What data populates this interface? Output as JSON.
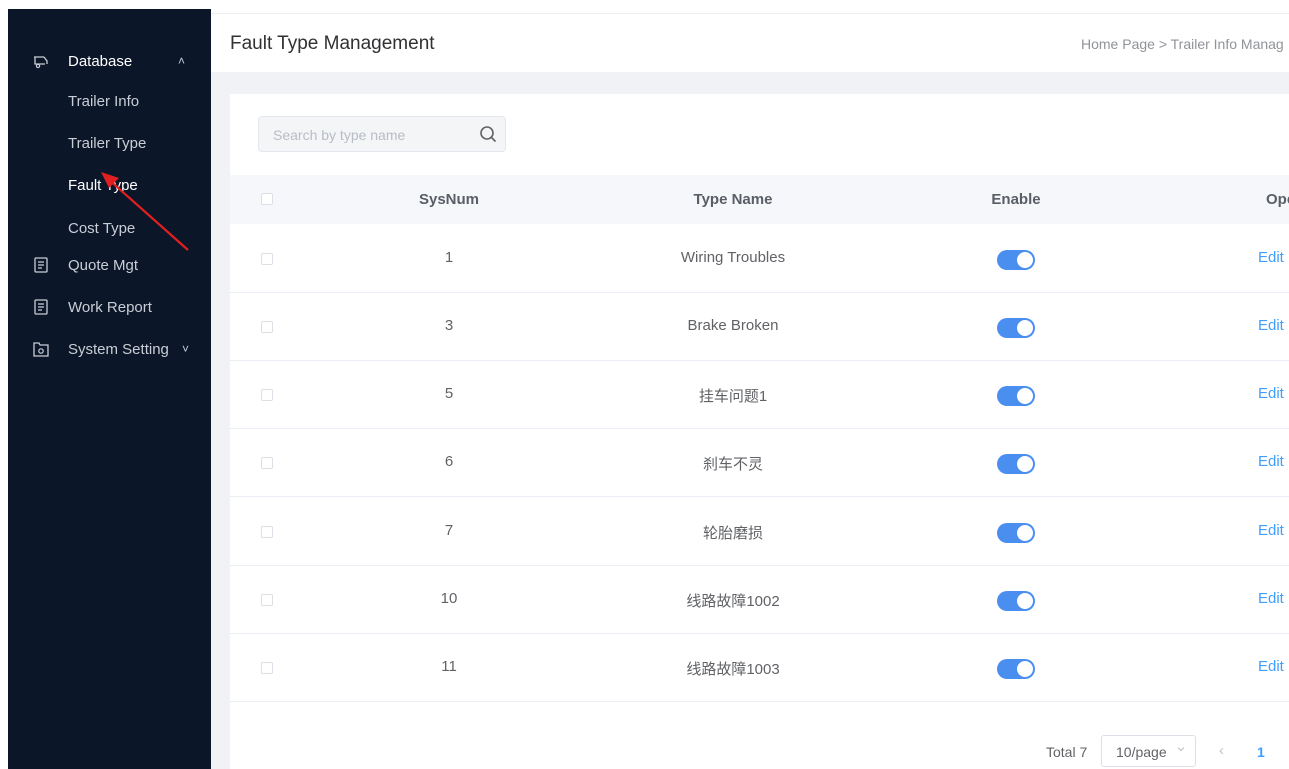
{
  "sidebar": {
    "database": {
      "label": "Database",
      "icon": "trailer-icon"
    },
    "submenu": [
      {
        "label": "Trailer Info"
      },
      {
        "label": "Trailer Type"
      },
      {
        "label": "Fault Type",
        "active": true
      },
      {
        "label": "Cost Type"
      }
    ],
    "quote": {
      "label": "Quote Mgt",
      "icon": "document-icon"
    },
    "report": {
      "label": "Work Report",
      "icon": "document-icon"
    },
    "settings": {
      "label": "System Setting",
      "icon": "settings-folder-icon"
    }
  },
  "header": {
    "title": "Fault Type Management",
    "breadcrumb": "Home Page > Trailer Info Manag"
  },
  "search": {
    "placeholder": "Search by type name",
    "value": ""
  },
  "table": {
    "columns": {
      "sysnum": "SysNum",
      "type_name": "Type Name",
      "enable": "Enable",
      "operation": "Ope"
    },
    "rows": [
      {
        "sysnum": "1",
        "type_name": "Wiring Troubles",
        "enabled": true,
        "action": "Edit"
      },
      {
        "sysnum": "3",
        "type_name": "Brake Broken",
        "enabled": true,
        "action": "Edit"
      },
      {
        "sysnum": "5",
        "type_name": "挂车问题1",
        "enabled": true,
        "action": "Edit"
      },
      {
        "sysnum": "6",
        "type_name": "刹车不灵",
        "enabled": true,
        "action": "Edit"
      },
      {
        "sysnum": "7",
        "type_name": "轮胎磨损",
        "enabled": true,
        "action": "Edit"
      },
      {
        "sysnum": "10",
        "type_name": "线路故障1002",
        "enabled": true,
        "action": "Edit"
      },
      {
        "sysnum": "11",
        "type_name": "线路故障1003",
        "enabled": true,
        "action": "Edit"
      }
    ]
  },
  "pagination": {
    "total": "Total 7",
    "page_size": "10/page",
    "current_page": "1"
  },
  "colors": {
    "sidebar_bg": "#0b1628",
    "accent": "#409eff",
    "switch_on": "#4a8ff0",
    "annotation_arrow": "#e02020"
  }
}
